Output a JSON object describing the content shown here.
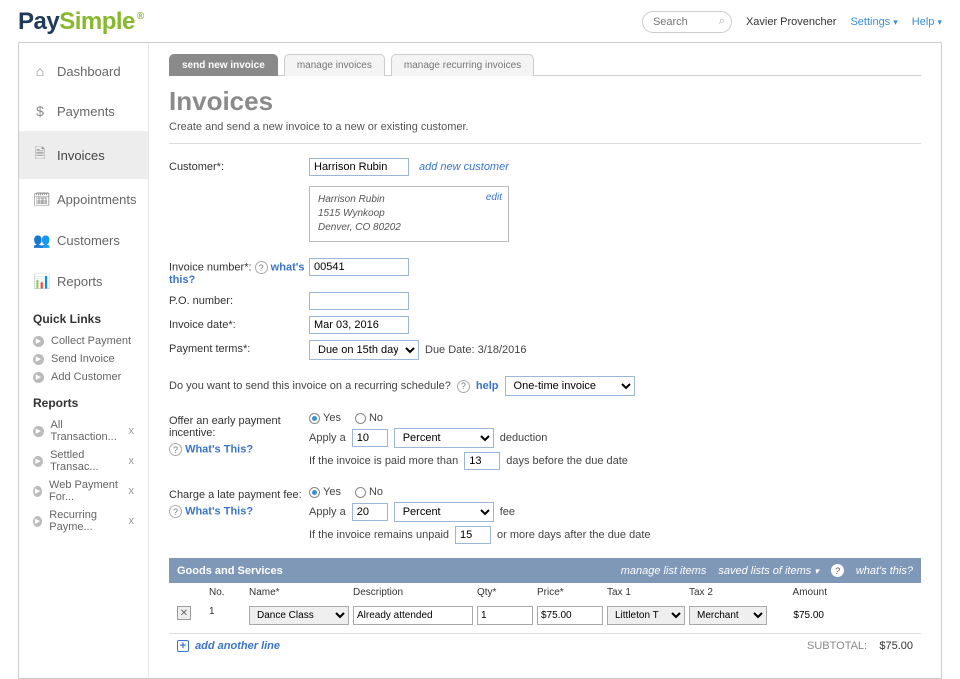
{
  "topbar": {
    "logo_pay": "Pay",
    "logo_simple": "Simple",
    "search_placeholder": "Search",
    "user": "Xavier Provencher",
    "settings": "Settings",
    "help": "Help"
  },
  "sidebar": {
    "nav": [
      {
        "icon": "home",
        "label": "Dashboard"
      },
      {
        "icon": "dollar",
        "label": "Payments"
      },
      {
        "icon": "file",
        "label": "Invoices",
        "active": true
      },
      {
        "icon": "calendar",
        "label": "Appointments"
      },
      {
        "icon": "users",
        "label": "Customers"
      },
      {
        "icon": "bars",
        "label": "Reports"
      }
    ],
    "quick_heading": "Quick Links",
    "quick": [
      {
        "label": "Collect Payment"
      },
      {
        "label": "Send Invoice"
      },
      {
        "label": "Add Customer"
      }
    ],
    "reports_heading": "Reports",
    "reports": [
      {
        "label": "All Transaction..."
      },
      {
        "label": "Settled Transac..."
      },
      {
        "label": "Web Payment For..."
      },
      {
        "label": "Recurring Payme..."
      }
    ]
  },
  "tabs": [
    "send new invoice",
    "manage invoices",
    "manage recurring invoices"
  ],
  "page": {
    "title": "Invoices",
    "subtitle": "Create and send a new invoice to a new or existing customer."
  },
  "form": {
    "customer_label": "Customer*:",
    "customer_value": "Harrison Rubin",
    "add_customer": "add new customer",
    "customer_card": {
      "name": "Harrison Rubin",
      "addr1": "1515 Wynkoop",
      "addr2": "Denver, CO 80202",
      "edit": "edit"
    },
    "invnum_label": "Invoice number*:",
    "whats_this": "what's this?",
    "invnum_value": "00541",
    "po_label": "P.O. number:",
    "invdate_label": "Invoice date*:",
    "invdate_value": "Mar 03, 2016",
    "terms_label": "Payment terms*:",
    "terms_value": "Due on 15th day",
    "due_label": "Due Date: 3/18/2016",
    "recurring_q": "Do you want to send this invoice on a recurring schedule?",
    "help_link": "help",
    "recurring_value": "One-time invoice",
    "early_label": "Offer an early payment incentive:",
    "whats_this_cap": "What's This?",
    "yes": "Yes",
    "no": "No",
    "apply_a": "Apply a",
    "early_amount": "10",
    "percent": "Percent",
    "deduction_suffix": "deduction",
    "early_note_prefix": "If the invoice is paid more than",
    "early_days": "13",
    "early_note_suffix": "days before the due date",
    "late_label": "Charge a late payment fee:",
    "late_amount": "20",
    "fee_suffix": "fee",
    "late_note_prefix": "If the invoice remains unpaid",
    "late_days": "15",
    "late_note_suffix": "or more days after the due date"
  },
  "gs": {
    "header_title": "Goods and Services",
    "manage": "manage list items",
    "saved": "saved lists of items",
    "whats_this": "what's this?",
    "cols": {
      "no": "No.",
      "name": "Name*",
      "desc": "Description",
      "qty": "Qty*",
      "price": "Price*",
      "tax1": "Tax 1",
      "tax2": "Tax 2",
      "amount": "Amount"
    },
    "row": {
      "no": "1",
      "name": "Dance Class",
      "desc": "Already attended",
      "qty": "1",
      "price": "$75.00",
      "tax1": "Littleton T",
      "tax2": "Merchant",
      "amount": "$75.00"
    },
    "add_line": "add another line",
    "subtotal_label": "SUBTOTAL:",
    "subtotal_value": "$75.00"
  }
}
